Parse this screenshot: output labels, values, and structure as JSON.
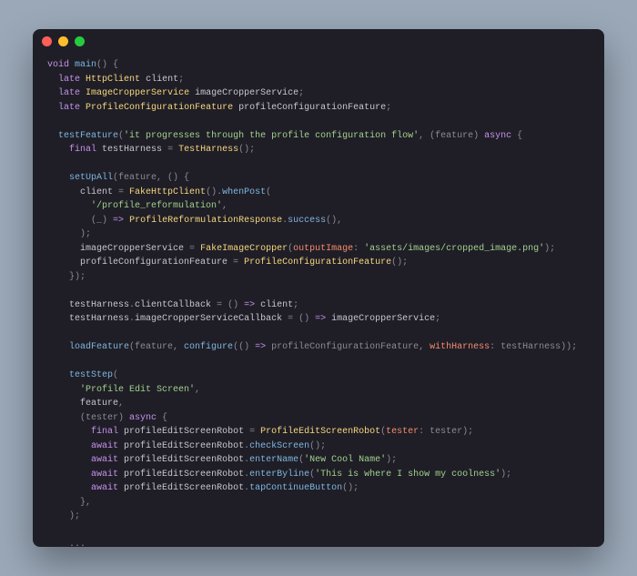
{
  "titlebar": {
    "close_name": "close",
    "minimize_name": "minimize",
    "zoom_name": "zoom"
  },
  "code": {
    "l1": {
      "kw1": "void",
      "fn": "main",
      "pn": "() {"
    },
    "l2": {
      "kw": "late",
      "type": "HttpClient",
      "id": "client",
      "pn": ";"
    },
    "l3": {
      "kw": "late",
      "type": "ImageCropperService",
      "id": "imageCropperService",
      "pn": ";"
    },
    "l4": {
      "kw": "late",
      "type": "ProfileConfigurationFeature",
      "id": "profileConfigurationFeature",
      "pn": ";"
    },
    "l6": {
      "fn": "testFeature",
      "p1": "(",
      "str": "'it progresses through the profile configuration flow'",
      "p2": ", (feature) ",
      "kw": "async",
      "p3": " {"
    },
    "l7": {
      "kw": "final",
      "id": "testHarness",
      "eq": " = ",
      "type": "TestHarness",
      "pn": "();"
    },
    "l9": {
      "fn": "setUpAll",
      "pn": "(feature, () {"
    },
    "l10": {
      "id": "client",
      "eq": " = ",
      "type": "FakeHttpClient",
      "p1": "().",
      "fn": "whenPost",
      "p2": "("
    },
    "l11": {
      "str": "'/profile_reformulation'",
      "pn": ","
    },
    "l12": {
      "p1": "(_) ",
      "kw": "=>",
      "p2": " ",
      "type": "ProfileReformulationResponse",
      "p3": ".",
      "fn": "success",
      "p4": "(),"
    },
    "l13": {
      "pn": ");"
    },
    "l14": {
      "id": "imageCropperService",
      "eq": " = ",
      "type": "FakeImageCropper",
      "p1": "(",
      "nm": "outputImage",
      "p2": ": ",
      "str": "'assets/images/cropped_image.png'",
      "p3": ");"
    },
    "l15": {
      "id": "profileConfigurationFeature",
      "eq": " = ",
      "type": "ProfileConfigurationFeature",
      "pn": "();"
    },
    "l16": {
      "pn": "});"
    },
    "l18": {
      "id1": "testHarness",
      "dot1": ".",
      "id2": "clientCallback",
      "eq": " = () ",
      "kw": "=>",
      "sp": " ",
      "id3": "client",
      "pn": ";"
    },
    "l19": {
      "id1": "testHarness",
      "dot1": ".",
      "id2": "imageCropperServiceCallback",
      "eq": " = () ",
      "kw": "=>",
      "sp": " ",
      "id3": "imageCropperService",
      "pn": ";"
    },
    "l21": {
      "fn": "loadFeature",
      "p1": "(feature, ",
      "fn2": "configure",
      "p2": "(() ",
      "kw": "=>",
      "p3": " profileConfigurationFeature, ",
      "nm": "withHarness",
      "p4": ": testHarness));"
    },
    "l23": {
      "fn": "testStep",
      "pn": "("
    },
    "l24": {
      "str": "'Profile Edit Screen'",
      "pn": ","
    },
    "l25": {
      "id": "feature",
      "pn": ","
    },
    "l26": {
      "p1": "(tester) ",
      "kw": "async",
      "p2": " {"
    },
    "l27": {
      "kw": "final",
      "id": "profileEditScreenRobot",
      "eq": " = ",
      "type": "ProfileEditScreenRobot",
      "p1": "(",
      "nm": "tester",
      "p2": ": tester);"
    },
    "l28": {
      "kw": "await",
      "sp": " ",
      "id": "profileEditScreenRobot",
      "dot": ".",
      "fn": "checkScreen",
      "pn": "();"
    },
    "l29": {
      "kw": "await",
      "sp": " ",
      "id": "profileEditScreenRobot",
      "dot": ".",
      "fn": "enterName",
      "p1": "(",
      "str": "'New Cool Name'",
      "p2": ");"
    },
    "l30": {
      "kw": "await",
      "sp": " ",
      "id": "profileEditScreenRobot",
      "dot": ".",
      "fn": "enterByline",
      "p1": "(",
      "str": "'This is where I show my coolness'",
      "p2": ");"
    },
    "l31": {
      "kw": "await",
      "sp": " ",
      "id": "profileEditScreenRobot",
      "dot": ".",
      "fn": "tapContinueButton",
      "pn": "();"
    },
    "l32": {
      "pn": "},"
    },
    "l33": {
      "pn": ");"
    },
    "l35": {
      "pn": "..."
    },
    "l36": {
      "pn": "});"
    },
    "l37": {
      "pn": "}"
    }
  }
}
